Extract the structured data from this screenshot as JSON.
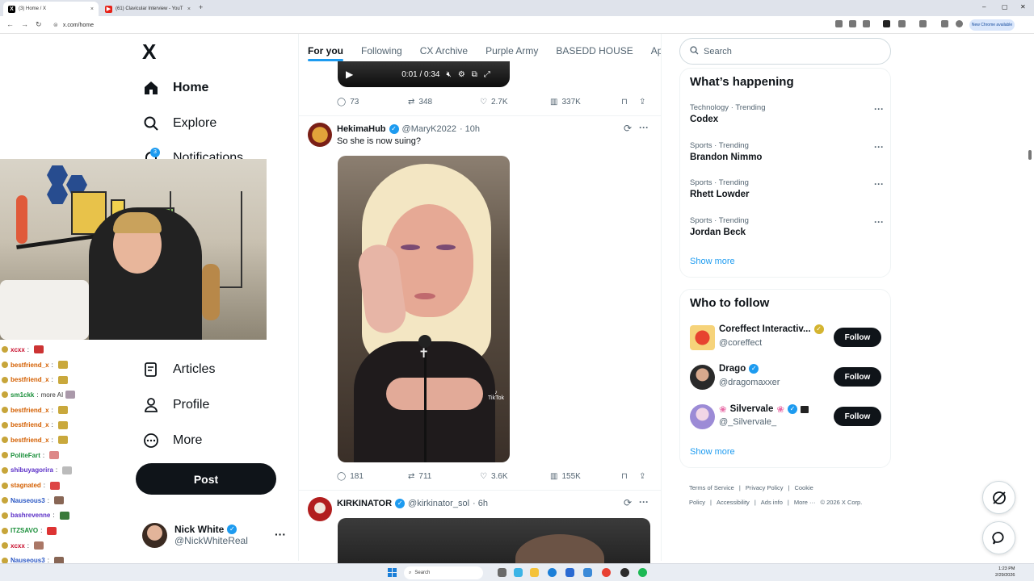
{
  "browser": {
    "tabs": [
      {
        "title": "(3) Home / X",
        "close": "×"
      },
      {
        "title": "(61) Clavicular Interview - YouT",
        "close": "×"
      }
    ],
    "new_tab": "+",
    "window_controls": {
      "minimize": "–",
      "maximize": "▢",
      "close": "✕"
    },
    "url": "x.com/home",
    "profile_chip": "New Chrome available"
  },
  "nav": {
    "logo": "X",
    "items": [
      {
        "label": "Home",
        "icon": "home-icon"
      },
      {
        "label": "Explore",
        "icon": "search-icon"
      },
      {
        "label": "Notifications",
        "icon": "bell-icon",
        "badge": "3"
      },
      {
        "label": "Articles",
        "icon": "articles-icon"
      },
      {
        "label": "Profile",
        "icon": "person-icon"
      },
      {
        "label": "More",
        "icon": "more-circle-icon"
      }
    ],
    "post_label": "Post",
    "account": {
      "name": "Nick White",
      "handle": "@NickWhiteReal",
      "more": "···"
    }
  },
  "chat": [
    {
      "user": "xcxx",
      "msg": ""
    },
    {
      "user": "bestfriend_x",
      "msg": ""
    },
    {
      "user": "bestfriend_x",
      "msg": ""
    },
    {
      "user": "sm1ckk",
      "msg": "more AI"
    },
    {
      "user": "bestfriend_x",
      "msg": ""
    },
    {
      "user": "bestfriend_x",
      "msg": ""
    },
    {
      "user": "bestfriend_x",
      "msg": ""
    },
    {
      "user": "PoliteFart",
      "msg": ""
    },
    {
      "user": "shibuyagorira",
      "msg": ""
    },
    {
      "user": "stagnated",
      "msg": ""
    },
    {
      "user": "Nauseous3",
      "msg": ""
    },
    {
      "user": "bashrevenne",
      "msg": ""
    },
    {
      "user": "ITZSAVO",
      "msg": ""
    },
    {
      "user": "xcxx",
      "msg": ""
    },
    {
      "user": "Nauseous3",
      "msg": ""
    }
  ],
  "timeline": {
    "tabs": [
      "For you",
      "Following",
      "CX Archive",
      "Purple Army",
      "BASEDD HOUSE",
      "Ape"
    ],
    "video_bar": {
      "time": "0:01 / 0:34"
    },
    "tweet0_actions": {
      "replies": "73",
      "reposts": "348",
      "likes": "2.7K",
      "views": "337K"
    },
    "tweet1": {
      "name": "HekimaHub",
      "handle": "@MaryK2022",
      "time": "· 10h",
      "text": "So she is now suing?",
      "overlay_label": "TikTok",
      "actions": {
        "replies": "181",
        "reposts": "711",
        "likes": "3.6K",
        "views": "155K"
      }
    },
    "tweet2": {
      "name": "KIRKINATOR",
      "handle": "@kirkinator_sol",
      "time": "· 6h"
    }
  },
  "right": {
    "search_placeholder": "Search",
    "happening_title": "What’s happening",
    "trends": [
      {
        "meta": "Technology · Trending",
        "topic": "Codex"
      },
      {
        "meta": "Sports · Trending",
        "topic": "Brandon Nimmo"
      },
      {
        "meta": "Sports · Trending",
        "topic": "Rhett Lowder"
      },
      {
        "meta": "Sports · Trending",
        "topic": "Jordan Beck"
      }
    ],
    "show_more": "Show more",
    "who_title": "Who to follow",
    "follow_suggestions": [
      {
        "name": "Coreffect Interactiv...",
        "handle": "@coreffect",
        "button": "Follow"
      },
      {
        "name": "Drago",
        "handle": "@dragomaxxer",
        "button": "Follow"
      },
      {
        "name": "Silvervale",
        "handle": "@_Silvervale_",
        "button": "Follow"
      }
    ],
    "footer": [
      "Terms of Service",
      "|",
      "Privacy Policy",
      "|",
      "Cookie Policy",
      "|",
      "Accessibility",
      "|",
      "Ads info",
      "|",
      "More ···",
      "© 2026 X Corp."
    ]
  },
  "taskbar": {
    "search": "Search",
    "time": "1:23 PM",
    "date": "2/29/2026"
  },
  "colors": {
    "accent": "#1d9bf0",
    "text": "#0f1419",
    "muted": "#536471"
  }
}
